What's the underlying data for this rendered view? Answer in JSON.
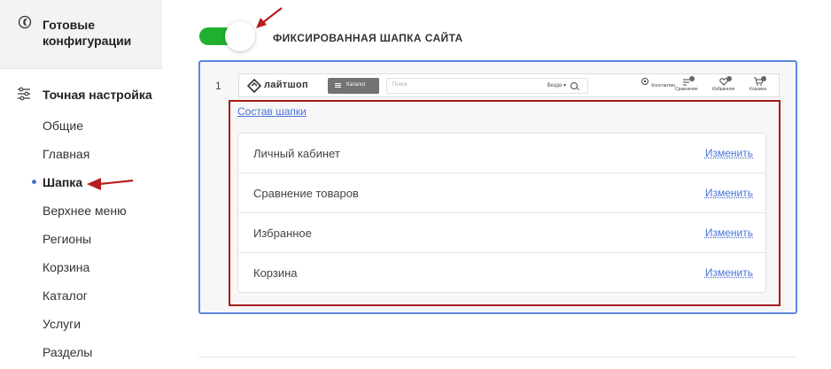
{
  "sidebar": {
    "ready_configs": "Готовые конфигурации",
    "fine_tuning": "Точная настройка",
    "items": [
      {
        "label": "Общие",
        "active": false
      },
      {
        "label": "Главная",
        "active": false
      },
      {
        "label": "Шапка",
        "active": true
      },
      {
        "label": "Верхнее меню",
        "active": false
      },
      {
        "label": "Регионы",
        "active": false
      },
      {
        "label": "Корзина",
        "active": false
      },
      {
        "label": "Каталог",
        "active": false
      },
      {
        "label": "Услуги",
        "active": false
      },
      {
        "label": "Разделы",
        "active": false
      }
    ]
  },
  "main": {
    "toggle_label": "ФИКСИРОВАННАЯ ШАПКА САЙТА",
    "toggle_on": true,
    "card_number": "1",
    "preview": {
      "logo": "лайтшоп",
      "catalog": "Каталог",
      "search_placeholder": "Поиск",
      "search_scope": "Везде ▾",
      "actions": [
        "Константин",
        "Сравнение",
        "Избранное",
        "Корзина"
      ]
    },
    "compose_link": "Состав шапки",
    "rows": [
      {
        "name": "Личный кабинет",
        "edit": "Изменить"
      },
      {
        "name": "Сравнение товаров",
        "edit": "Изменить"
      },
      {
        "name": "Избранное",
        "edit": "Изменить"
      },
      {
        "name": "Корзина",
        "edit": "Изменить"
      }
    ]
  },
  "colors": {
    "accent": "#4a73d9",
    "toggle": "#21b02f",
    "card_border": "#5d86df",
    "highlight": "#a51c1c"
  }
}
